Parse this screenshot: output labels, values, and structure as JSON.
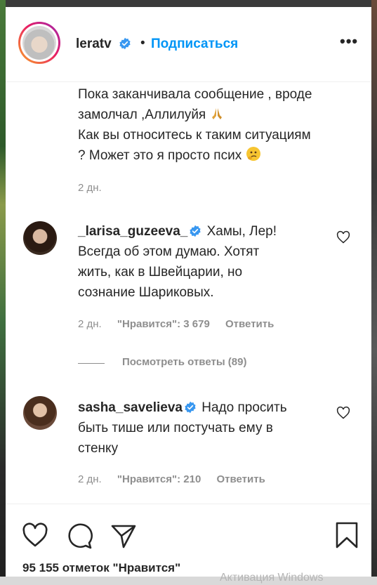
{
  "post": {
    "username": "leratv",
    "dot": "•",
    "follow_label": "Подписаться",
    "more_label": "•••",
    "caption_line1": "Пока заканчивала сообщение , вроде",
    "caption_line2": "замолчал ,Аллилуйя",
    "caption_line3": "Как вы относитесь к таким ситуациям",
    "caption_line4": "? Может это я просто псих",
    "caption_time": "2 дн."
  },
  "comments": [
    {
      "username": "_larisa_guzeeva_",
      "text_start": "Хамы, Лер!",
      "text_rest1": "Всегда об этом думаю. Хотят",
      "text_rest2": "жить, как в Швейцарии, но",
      "text_rest3": "сознание Шариковых.",
      "time": "2 дн.",
      "likes": "\"Нравится\": 3 679",
      "reply_label": "Ответить",
      "view_replies": "Посмотреть ответы (89)"
    },
    {
      "username": "sasha_savelieva",
      "text_start": "Надо просить",
      "text_rest1": "быть тише или постучать ему в",
      "text_rest2": "стенку",
      "time": "2 дн.",
      "likes": "\"Нравится\": 210",
      "reply_label": "Ответить"
    }
  ],
  "footer": {
    "likes_count": "95 155 отметок \"Нравится\""
  },
  "watermark": "Активация Windows",
  "colors": {
    "link": "#0095f6",
    "text": "#262626",
    "muted": "#8e8e8e"
  },
  "icons": [
    "verified-badge-icon",
    "more-options-icon",
    "heart-icon",
    "comment-icon",
    "share-icon",
    "bookmark-icon"
  ]
}
